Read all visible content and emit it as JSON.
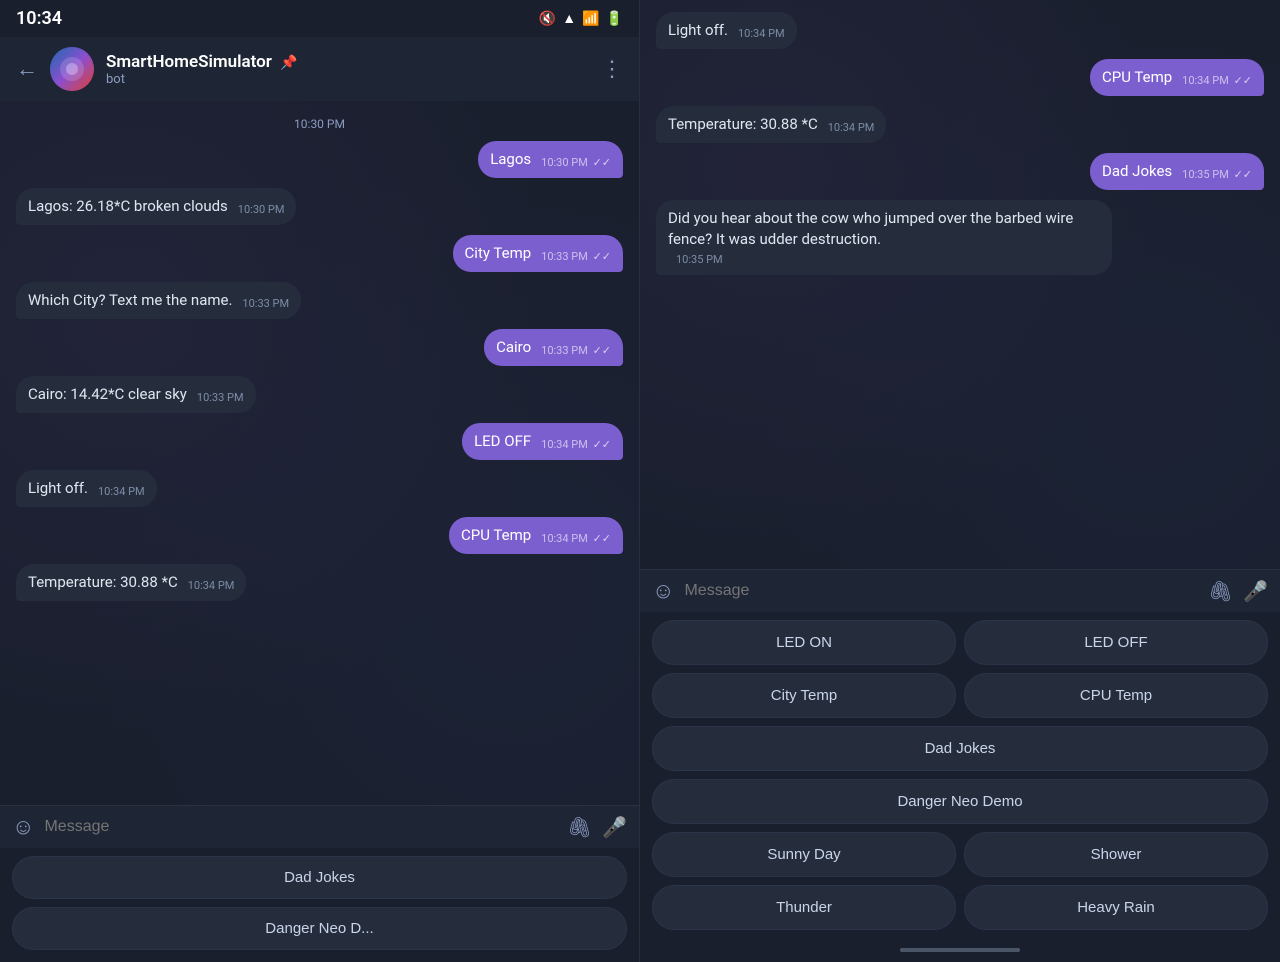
{
  "leftPanel": {
    "statusBar": {
      "time": "10:34"
    },
    "header": {
      "botName": "SmartHomeSimulator",
      "botPin": "✦",
      "botType": "bot",
      "moreIcon": "⋮"
    },
    "messages": [
      {
        "id": "ts1",
        "type": "timestamp",
        "text": "10:30 PM"
      },
      {
        "id": "m1",
        "type": "sent",
        "text": "Lagos",
        "time": "10:30 PM"
      },
      {
        "id": "m2",
        "type": "received",
        "text": "Lagos: 26.18*C broken clouds",
        "time": "10:30 PM"
      },
      {
        "id": "m3",
        "type": "sent",
        "text": "City Temp",
        "time": "10:33 PM"
      },
      {
        "id": "m4",
        "type": "received",
        "text": "Which City? Text me the name.",
        "time": "10:33 PM"
      },
      {
        "id": "m5",
        "type": "sent",
        "text": "Cairo",
        "time": "10:33 PM"
      },
      {
        "id": "m6",
        "type": "received",
        "text": "Cairo: 14.42*C clear sky",
        "time": "10:33 PM"
      },
      {
        "id": "m7",
        "type": "sent",
        "text": "LED OFF",
        "time": "10:34 PM"
      },
      {
        "id": "m8",
        "type": "received",
        "text": "Light off.",
        "time": "10:34 PM"
      },
      {
        "id": "m9",
        "type": "sent",
        "text": "CPU Temp",
        "time": "10:34 PM"
      },
      {
        "id": "m10",
        "type": "received",
        "text": "Temperature: 30.88 *C",
        "time": "10:34 PM"
      }
    ],
    "inputPlaceholder": "Message",
    "quickActions": [
      {
        "id": "qa1",
        "label": "Dad Jokes"
      },
      {
        "id": "qa2",
        "label": "Danger Neo D..."
      }
    ]
  },
  "rightPanel": {
    "messages": [
      {
        "id": "r1",
        "type": "received",
        "text": "Light off.",
        "time": "10:34 PM"
      },
      {
        "id": "r2",
        "type": "sent",
        "text": "CPU Temp",
        "time": "10:34 PM"
      },
      {
        "id": "r3",
        "type": "received",
        "text": "Temperature: 30.88 *C",
        "time": "10:34 PM"
      },
      {
        "id": "r4",
        "type": "sent",
        "text": "Dad Jokes",
        "time": "10:35 PM"
      },
      {
        "id": "r5",
        "type": "received",
        "text": "Did you hear about the cow who jumped over the barbed wire fence? It was udder destruction.",
        "time": "10:35 PM"
      }
    ],
    "inputPlaceholder": "Message",
    "quickActions": {
      "row1": [
        "LED ON",
        "LED OFF"
      ],
      "row2": [
        "City Temp",
        "CPU Temp"
      ],
      "row3": [
        "Dad Jokes"
      ],
      "row4": [
        "Danger Neo Demo"
      ],
      "row5": [
        "Sunny Day",
        "Shower"
      ],
      "row6": [
        "Thunder",
        "Heavy Rain"
      ]
    }
  }
}
